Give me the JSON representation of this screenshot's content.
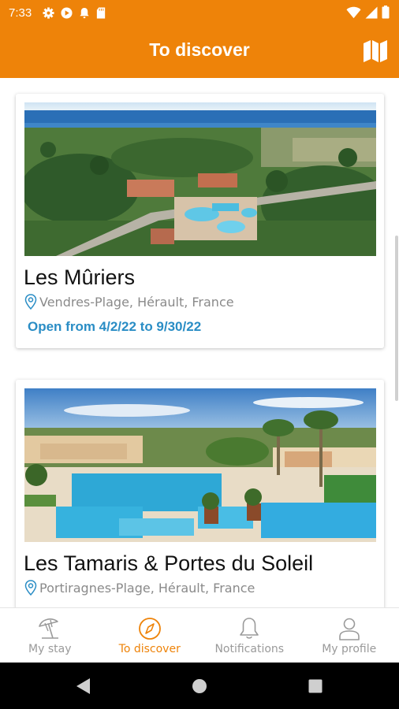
{
  "status": {
    "time": "7:33",
    "icons": [
      "gear-icon",
      "play-icon",
      "notification-bell-icon",
      "sd-card-icon",
      "wifi-icon",
      "signal-icon",
      "battery-icon"
    ]
  },
  "header": {
    "title": "To discover",
    "map_icon": "map-icon",
    "color": "#ee8309"
  },
  "campsites": [
    {
      "name": "Les Mûriers",
      "location": "Vendres-Plage, Hérault, France",
      "open": "Open from 4/2/22 to 9/30/22"
    },
    {
      "name": "Les Tamaris & Portes du Soleil",
      "location": "Portiragnes-Plage, Hérault, France"
    }
  ],
  "bottom_nav": [
    {
      "label": "My stay",
      "icon": "beach-umbrella-icon",
      "active": false
    },
    {
      "label": "To discover",
      "icon": "compass-icon",
      "active": true
    },
    {
      "label": "Notifications",
      "icon": "bell-icon",
      "active": false
    },
    {
      "label": "My profile",
      "icon": "person-icon",
      "active": false
    }
  ],
  "colors": {
    "accent": "#ee8309",
    "link": "#2a8dc5",
    "inactive": "#9a9a9a"
  }
}
